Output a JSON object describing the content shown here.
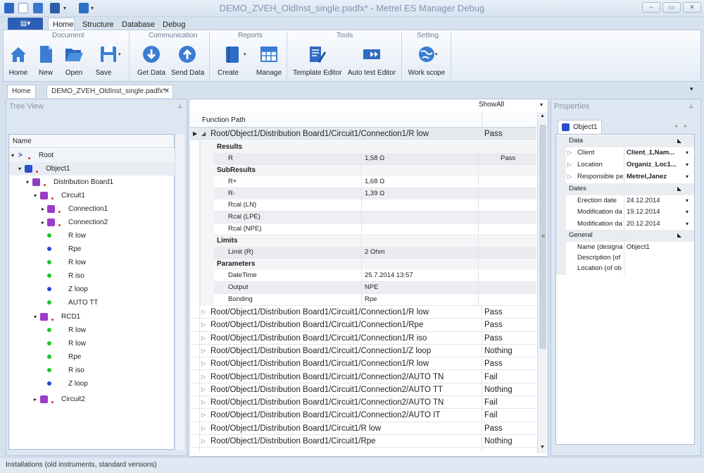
{
  "titlebar": {
    "title": "DEMO_ZVEH_OldInst_single.padfx* - Metrel ES Manager Debug",
    "min": "–",
    "max": "▭",
    "close": "✕"
  },
  "app_button": "▤▾",
  "ribbon_tabs": [
    "Home",
    "Structure",
    "Database",
    "Debug"
  ],
  "groups": {
    "document": "Document",
    "communication": "Communication",
    "reports": "Reports",
    "tools": "Tools",
    "setting": "Setting"
  },
  "buttons": {
    "home": "Home",
    "new": "New",
    "open": "Open",
    "save": "Save",
    "get_data": "Get Data",
    "send_data": "Send Data",
    "create": "Create",
    "manage": "Manage",
    "template_editor": "Template Editor",
    "auto_test_editor": "Auto test Editor",
    "work_scope": "Work scope"
  },
  "doc_tabs": {
    "home": "Home",
    "file": "DEMO_ZVEH_OldInst_single.padfx*",
    "close": "✕"
  },
  "tree": {
    "title": "Tree View",
    "col": "Name",
    "items": [
      "Root",
      "Object1",
      "Distribution Board1",
      "Circuit1",
      "Connection1",
      "Connection2",
      "R low",
      "Rpe",
      "R low",
      "R iso",
      "Z loop",
      "AUTO TT",
      "RCD1",
      "R low",
      "R low",
      "Rpe",
      "R iso",
      "Z loop",
      "Circuit2"
    ]
  },
  "grid": {
    "showall": "ShowAll",
    "col": "Function Path",
    "expanded": {
      "path": "Root/Object1/Distribution  Board1/Circuit1/Connection1/R low",
      "status": "Pass"
    },
    "sections": {
      "results": "Results",
      "subresults": "SubResults",
      "limits": "Limits",
      "parameters": "Parameters"
    },
    "results": [
      {
        "name": "R",
        "value": "1,58 Ω",
        "status": "Pass"
      }
    ],
    "subresults": [
      {
        "name": "R+",
        "value": "1,68 Ω"
      },
      {
        "name": "R-",
        "value": "1,39 Ω"
      },
      {
        "name": "Rcal (LN)",
        "value": ""
      },
      {
        "name": "Rcal (LPE)",
        "value": ""
      },
      {
        "name": "Rcal (NPE)",
        "value": ""
      }
    ],
    "limits": [
      {
        "name": "Limit  (R)",
        "value": "2 Ohm"
      }
    ],
    "parameters": [
      {
        "name": "DateTime",
        "value": "25.7.2014 13:57"
      },
      {
        "name": "Output",
        "value": "NPE"
      },
      {
        "name": "Bonding",
        "value": "Rpe"
      }
    ],
    "rows": [
      {
        "path": "Root/Object1/Distribution  Board1/Circuit1/Connection1/R low",
        "status": "Pass"
      },
      {
        "path": "Root/Object1/Distribution  Board1/Circuit1/Connection1/Rpe",
        "status": "Pass"
      },
      {
        "path": "Root/Object1/Distribution  Board1/Circuit1/Connection1/R iso",
        "status": "Pass"
      },
      {
        "path": "Root/Object1/Distribution  Board1/Circuit1/Connection1/Z loop",
        "status": "Nothing"
      },
      {
        "path": "Root/Object1/Distribution  Board1/Circuit1/Connection1/R low",
        "status": "Pass"
      },
      {
        "path": "Root/Object1/Distribution  Board1/Circuit1/Connection2/AUTO TN",
        "status": "Fail"
      },
      {
        "path": "Root/Object1/Distribution  Board1/Circuit1/Connection2/AUTO TT",
        "status": "Nothing"
      },
      {
        "path": "Root/Object1/Distribution  Board1/Circuit1/Connection2/AUTO TN",
        "status": "Fail"
      },
      {
        "path": "Root/Object1/Distribution  Board1/Circuit1/Connection2/AUTO IT",
        "status": "Fail"
      },
      {
        "path": "Root/Object1/Distribution  Board1/Circuit1/R low",
        "status": "Pass"
      },
      {
        "path": "Root/Object1/Distribution  Board1/Circuit1/Rpe",
        "status": "Nothing"
      }
    ]
  },
  "properties": {
    "title": "Properties",
    "tab": "Object1",
    "data_label": "Data",
    "dates_label": "Dates",
    "general_label": "General",
    "data": [
      {
        "name": "Client",
        "value": "Client_1,Nam..."
      },
      {
        "name": "Location",
        "value": "Organiz_Loc1..."
      },
      {
        "name": "Responsible pe",
        "value": "Metrel,Janez"
      }
    ],
    "dates": [
      {
        "name": "Erection date",
        "value": "24.12.2014"
      },
      {
        "name": "Modification da",
        "value": "19.12.2014"
      },
      {
        "name": "Modification da",
        "value": "20.12.2014"
      }
    ],
    "general": [
      {
        "name": "Name (designa",
        "value": "Object1"
      },
      {
        "name": "Description (of",
        "value": ""
      },
      {
        "name": "Location (of ob",
        "value": ""
      }
    ]
  },
  "status": "Installations (old instruments, standard versions)",
  "colors": {
    "accent": "#2b5fb3",
    "pass": "#222",
    "green_dot": "#22c32a",
    "blue_dot": "#2646d6"
  }
}
